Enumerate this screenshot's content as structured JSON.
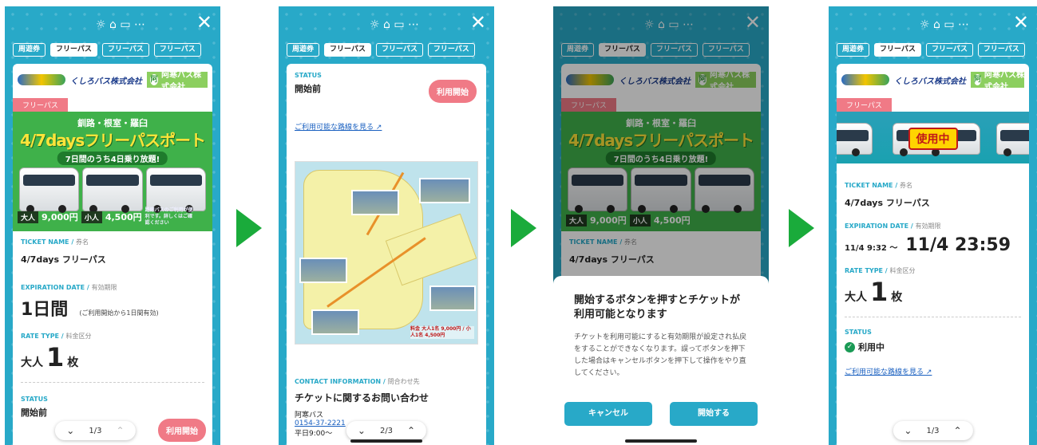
{
  "top_icons": "☼ ⌂ ▭ ⋯",
  "close_label": "✕",
  "tabs": [
    "周遊券",
    "フリーパス",
    "フリーパス",
    "フリーパス"
  ],
  "logos": {
    "kushiro": "くしろバス株式会社",
    "akan": "阿寒バス株式会社",
    "kushiro_small": "株式会社"
  },
  "poster": {
    "badge": "フリーパス",
    "route": "釧路・根室・羅臼",
    "title": "4/7daysフリーパスポート",
    "subtitle": "7日間のうち4日乗り放題!",
    "adult_label": "大人",
    "adult_price": "9,000円",
    "child_label": "小人",
    "child_price": "4,500円",
    "note": "路線バスのご利用が便利です。詳しくはご確認ください"
  },
  "ticket": {
    "name_label": "TICKET NAME",
    "name_label_jp": "券名",
    "name": "4/7days フリーパス",
    "exp_label": "EXPIRATION DATE",
    "exp_label_jp": "有効期限",
    "exp_value": "1日間",
    "exp_note": "(ご利用開始から1日間有効)",
    "rate_label": "RATE TYPE",
    "rate_label_jp": "料金区分",
    "rate_type": "大人",
    "rate_count": "1",
    "rate_unit": "枚",
    "status_label": "STATUS",
    "status_value": "開始前"
  },
  "start_button": "利用開始",
  "pager": [
    {
      "label": "1/3"
    },
    {
      "label": "2/3"
    },
    {
      "label": "1/3"
    }
  ],
  "screen2": {
    "status_label": "STATUS",
    "status_value": "開始前",
    "routes_link": "ご利用可能な路線を見る",
    "map_prices": "料金 大人1名 9,000円 / 小人1名 4,500円",
    "contact_label": "CONTACT INFORMATION",
    "contact_label_jp": "問合わせ先",
    "contact_title": "チケットに関するお問い合わせ",
    "company": "阿寒バス",
    "phone": "0154-37-2221",
    "hours": "平日9:00〜"
  },
  "dialog": {
    "title": "開始するボタンを押すとチケットが利用可能となります",
    "body": "チケットを利用可能にすると有効期限が設定され払戻をすることができなくなります。誤ってボタンを押下した場合はキャンセルボタンを押下して操作をやり直してください。",
    "cancel": "キャンセル",
    "confirm": "開始する"
  },
  "screen4": {
    "in_use_tag": "使用中",
    "exp_from": "11/4 9:32 〜",
    "exp_to": "11/4 23:59",
    "status_value": "利用中"
  },
  "colors": {
    "teal": "#28a9c8",
    "pink": "#f07a86",
    "arrow": "#1aab3b"
  }
}
